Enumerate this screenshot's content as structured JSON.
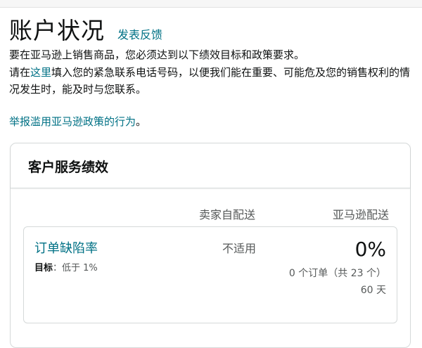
{
  "header": {
    "title": "账户状况",
    "feedback_label": "发表反馈"
  },
  "intro": {
    "line1": "要在亚马逊上销售商品，您必须达到以下绩效目标和政策要求。",
    "line2_prefix": "请在",
    "line2_link": "这里",
    "line2_suffix": "填入您的紧急联系电话号码，以便我们能在重要、可能危及您的销售权利的情况发生时，能及时与您联系。"
  },
  "report": {
    "link_label": "举报滥用亚马逊政策的行为",
    "suffix": "。"
  },
  "customer_service": {
    "title": "客户服务绩效",
    "col_seller": "卖家自配送",
    "col_amazon": "亚马逊配送",
    "metric": {
      "name": "订单缺陷率",
      "target_label": "目标",
      "target_value": "：低于 1%",
      "seller_value": "不适用",
      "amazon_value": "0%",
      "amazon_orders": "0 个订单（共 23 个）",
      "amazon_period": "60 天"
    }
  },
  "colors": {
    "link": "#007185",
    "text": "#0f1111",
    "muted": "#565959",
    "border": "#d5d9d9"
  }
}
